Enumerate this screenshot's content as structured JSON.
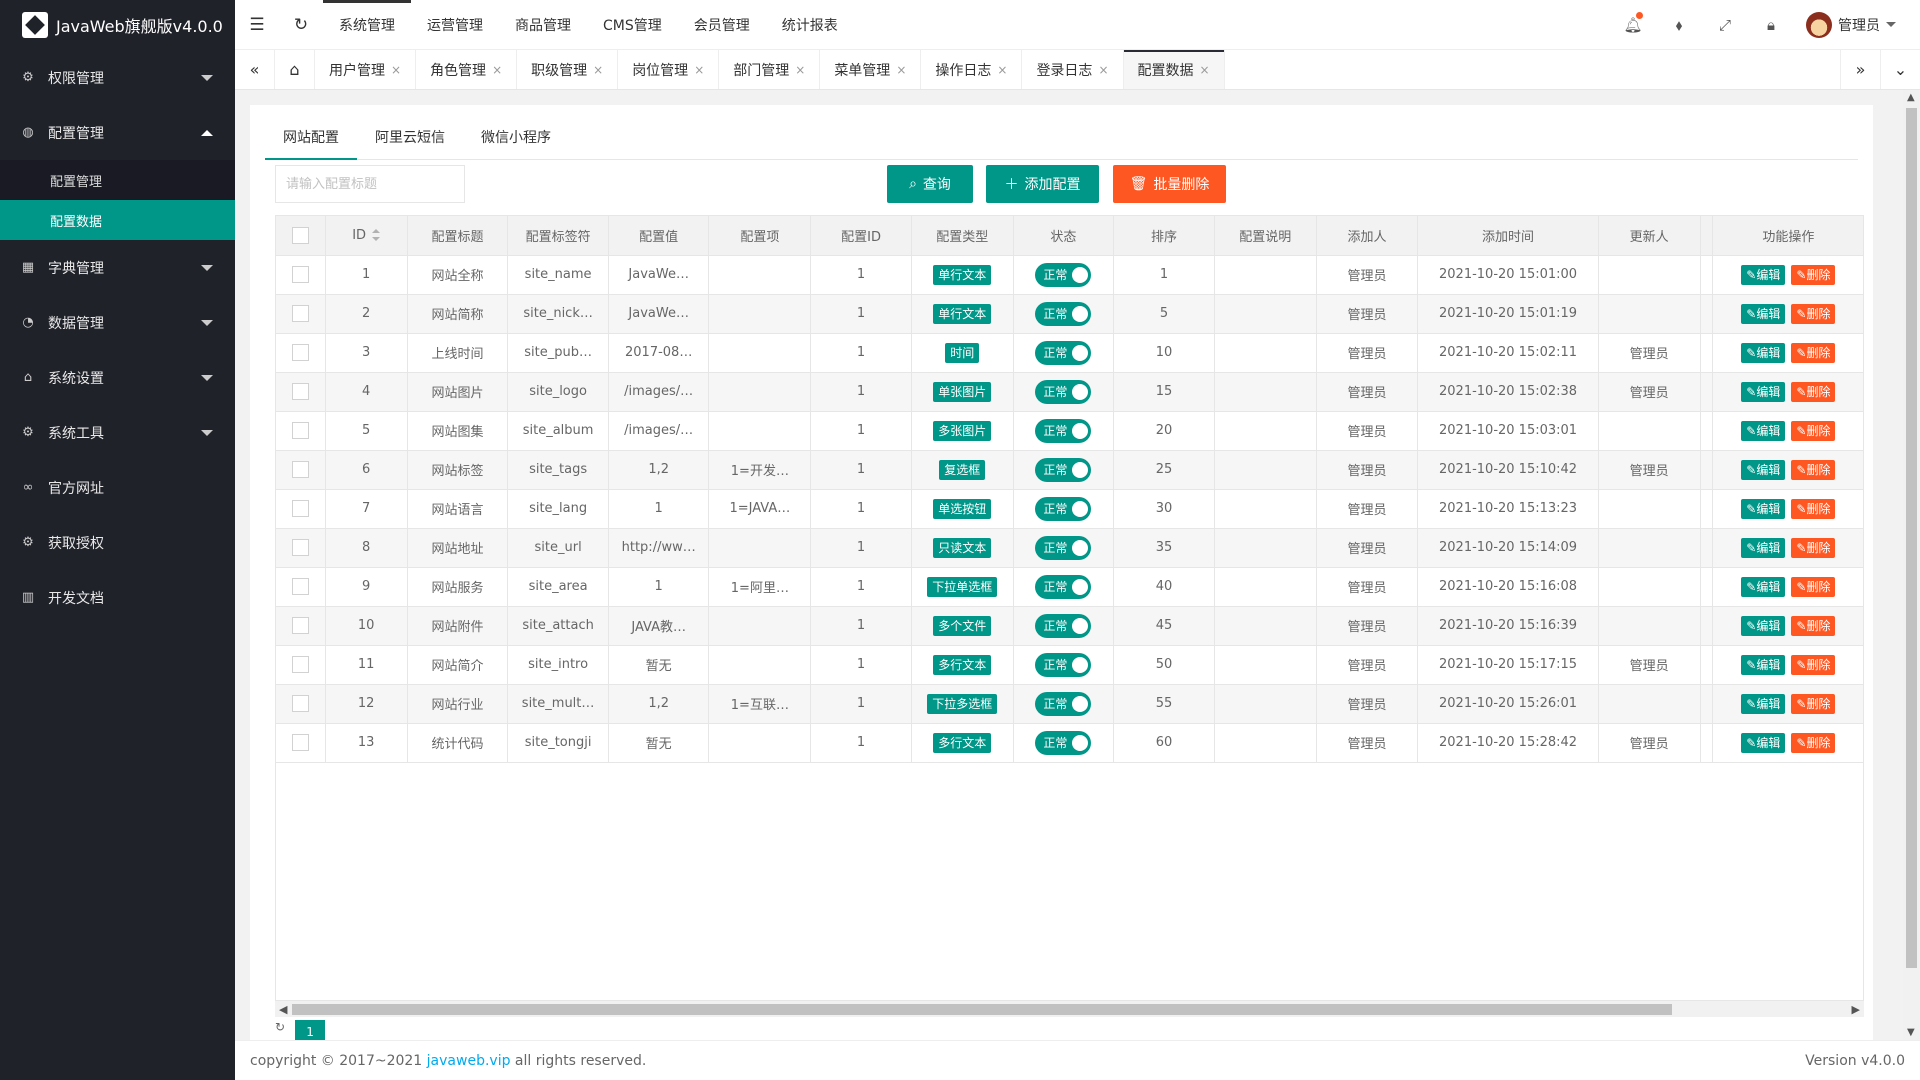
{
  "app": {
    "title": "JavaWeb旗舰版v4.0.0"
  },
  "sidebar": {
    "items": [
      {
        "icon": "gear-icon",
        "label": "权限管理",
        "expanded": false
      },
      {
        "icon": "globe-icon",
        "label": "配置管理",
        "expanded": true
      },
      {
        "icon": "grid-icon",
        "label": "字典管理",
        "expanded": false
      },
      {
        "icon": "gauge-icon",
        "label": "数据管理",
        "expanded": false
      },
      {
        "icon": "home-icon",
        "label": "系统设置",
        "expanded": false
      },
      {
        "icon": "gear-icon",
        "label": "系统工具",
        "expanded": false
      },
      {
        "icon": "link-icon",
        "label": "官方网址"
      },
      {
        "icon": "gear-icon",
        "label": "获取授权"
      },
      {
        "icon": "book-icon",
        "label": "开发文档"
      }
    ],
    "subitems": [
      "配置管理",
      "配置数据"
    ]
  },
  "topmenu": [
    "系统管理",
    "运营管理",
    "商品管理",
    "CMS管理",
    "会员管理",
    "统计报表"
  ],
  "user": {
    "name": "管理员"
  },
  "tabs": [
    "用户管理",
    "角色管理",
    "职级管理",
    "岗位管理",
    "部门管理",
    "菜单管理",
    "操作日志",
    "登录日志",
    "配置数据"
  ],
  "content_tabs": [
    "网站配置",
    "阿里云短信",
    "微信小程序"
  ],
  "search": {
    "placeholder": "请输入配置标题"
  },
  "buttons": {
    "query": "查询",
    "add": "添加配置",
    "batch_delete": "批量删除"
  },
  "table": {
    "headers": [
      "ID",
      "配置标题",
      "配置标签符",
      "配置值",
      "配置项",
      "配置ID",
      "配置类型",
      "状态",
      "排序",
      "配置说明",
      "添加人",
      "添加时间",
      "更新人",
      "功能操作"
    ],
    "status_label": "正常",
    "edit_label": "编辑",
    "delete_label": "删除",
    "rows": [
      {
        "id": "1",
        "title": "网站全称",
        "key": "site_name",
        "value": "JavaWe…",
        "options": "",
        "cid": "1",
        "type": "单行文本",
        "sort": "1",
        "note": "",
        "creator": "管理员",
        "created": "2021-10-20 15:01:00",
        "updater": ""
      },
      {
        "id": "2",
        "title": "网站简称",
        "key": "site_nick…",
        "value": "JavaWe…",
        "options": "",
        "cid": "1",
        "type": "单行文本",
        "sort": "5",
        "note": "",
        "creator": "管理员",
        "created": "2021-10-20 15:01:19",
        "updater": ""
      },
      {
        "id": "3",
        "title": "上线时间",
        "key": "site_pub…",
        "value": "2017-08…",
        "options": "",
        "cid": "1",
        "type": "时间",
        "sort": "10",
        "note": "",
        "creator": "管理员",
        "created": "2021-10-20 15:02:11",
        "updater": "管理员"
      },
      {
        "id": "4",
        "title": "网站图片",
        "key": "site_logo",
        "value": "/images/…",
        "options": "",
        "cid": "1",
        "type": "单张图片",
        "sort": "15",
        "note": "",
        "creator": "管理员",
        "created": "2021-10-20 15:02:38",
        "updater": "管理员"
      },
      {
        "id": "5",
        "title": "网站图集",
        "key": "site_album",
        "value": "/images/…",
        "options": "",
        "cid": "1",
        "type": "多张图片",
        "sort": "20",
        "note": "",
        "creator": "管理员",
        "created": "2021-10-20 15:03:01",
        "updater": ""
      },
      {
        "id": "6",
        "title": "网站标签",
        "key": "site_tags",
        "value": "1,2",
        "options": "1=开发…",
        "cid": "1",
        "type": "复选框",
        "sort": "25",
        "note": "",
        "creator": "管理员",
        "created": "2021-10-20 15:10:42",
        "updater": "管理员"
      },
      {
        "id": "7",
        "title": "网站语言",
        "key": "site_lang",
        "value": "1",
        "options": "1=JAVA…",
        "cid": "1",
        "type": "单选按钮",
        "sort": "30",
        "note": "",
        "creator": "管理员",
        "created": "2021-10-20 15:13:23",
        "updater": ""
      },
      {
        "id": "8",
        "title": "网站地址",
        "key": "site_url",
        "value": "http://ww…",
        "options": "",
        "cid": "1",
        "type": "只读文本",
        "sort": "35",
        "note": "",
        "creator": "管理员",
        "created": "2021-10-20 15:14:09",
        "updater": ""
      },
      {
        "id": "9",
        "title": "网站服务",
        "key": "site_area",
        "value": "1",
        "options": "1=阿里…",
        "cid": "1",
        "type": "下拉单选框",
        "sort": "40",
        "note": "",
        "creator": "管理员",
        "created": "2021-10-20 15:16:08",
        "updater": ""
      },
      {
        "id": "10",
        "title": "网站附件",
        "key": "site_attach",
        "value": "JAVA教…",
        "options": "",
        "cid": "1",
        "type": "多个文件",
        "sort": "45",
        "note": "",
        "creator": "管理员",
        "created": "2021-10-20 15:16:39",
        "updater": ""
      },
      {
        "id": "11",
        "title": "网站简介",
        "key": "site_intro",
        "value": "暂无",
        "options": "",
        "cid": "1",
        "type": "多行文本",
        "sort": "50",
        "note": "",
        "creator": "管理员",
        "created": "2021-10-20 15:17:15",
        "updater": "管理员"
      },
      {
        "id": "12",
        "title": "网站行业",
        "key": "site_mult…",
        "value": "1,2",
        "options": "1=互联…",
        "cid": "1",
        "type": "下拉多选框",
        "sort": "55",
        "note": "",
        "creator": "管理员",
        "created": "2021-10-20 15:26:01",
        "updater": ""
      },
      {
        "id": "13",
        "title": "统计代码",
        "key": "site_tongji",
        "value": "暂无",
        "options": "",
        "cid": "1",
        "type": "多行文本",
        "sort": "60",
        "note": "",
        "creator": "管理员",
        "created": "2021-10-20 15:28:42",
        "updater": "管理员"
      }
    ]
  },
  "pager": {
    "current": "1"
  },
  "footer": {
    "copyright": "copyright © 2017~2021",
    "link": "javaweb.vip",
    "rights": "all rights reserved.",
    "version": "Version v4.0.0"
  },
  "colors": {
    "accent": "#009688",
    "danger": "#ff5722",
    "sidebar": "#20222a"
  }
}
